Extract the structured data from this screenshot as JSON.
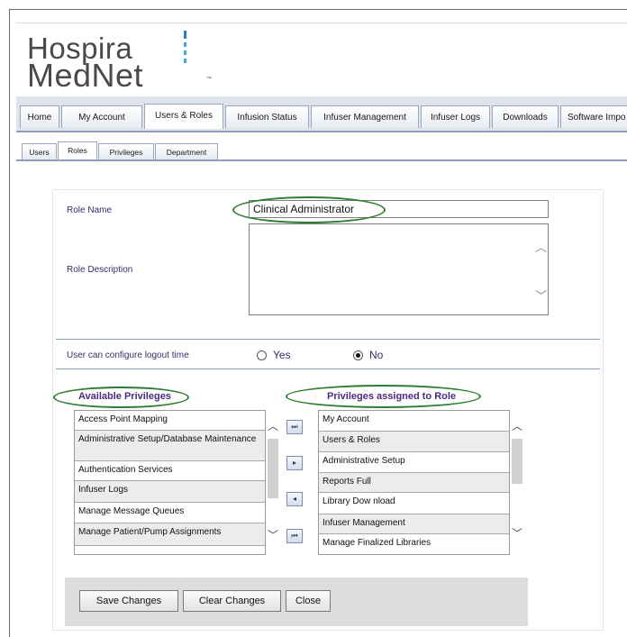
{
  "logo": {
    "line1": "Hospira",
    "line2": "MedNet",
    "tm": "™"
  },
  "main_tabs": [
    {
      "label": "Home"
    },
    {
      "label": "My Account"
    },
    {
      "label": "Users & Roles"
    },
    {
      "label": "Infusion Status"
    },
    {
      "label": "Infuser Management"
    },
    {
      "label": "Infuser Logs"
    },
    {
      "label": "Downloads"
    },
    {
      "label": "Software Impo"
    }
  ],
  "sub_tabs": [
    {
      "label": "Users"
    },
    {
      "label": "Roles"
    },
    {
      "label": "Privileges"
    },
    {
      "label": "Department"
    }
  ],
  "form": {
    "role_name_label": "Role Name",
    "role_name_value": "Clinical Administrator",
    "role_description_label": "Role Description",
    "role_description_value": "",
    "logout_label": "User can configure logout time",
    "yes_label": "Yes",
    "no_label": "No",
    "selected_option": "No"
  },
  "available": {
    "header": "Available Privileges",
    "items": [
      "Access Point Mapping",
      "Administrative Setup/Database Maintenance",
      "Authentication Services",
      "Infuser Logs",
      "Manage Message Queues",
      "Manage Patient/Pump Assignments"
    ]
  },
  "assigned": {
    "header": "Privileges assigned to Role",
    "items": [
      "My Account",
      "Users & Roles",
      "Administrative Setup",
      "Reports Full",
      "Library Dow nload",
      "Infuser Management",
      "Manage Finalized Libraries"
    ]
  },
  "move_buttons": {
    "all_right": "⏭",
    "right": "▸",
    "left": "◂",
    "all_left": "⏮"
  },
  "buttons": {
    "save": "Save Changes",
    "clear": "Clear Changes",
    "close": "Close"
  },
  "colors": {
    "oval": "#2e7d32",
    "header_text": "#4a2c80",
    "tab_underline": "#8aa0c2"
  }
}
